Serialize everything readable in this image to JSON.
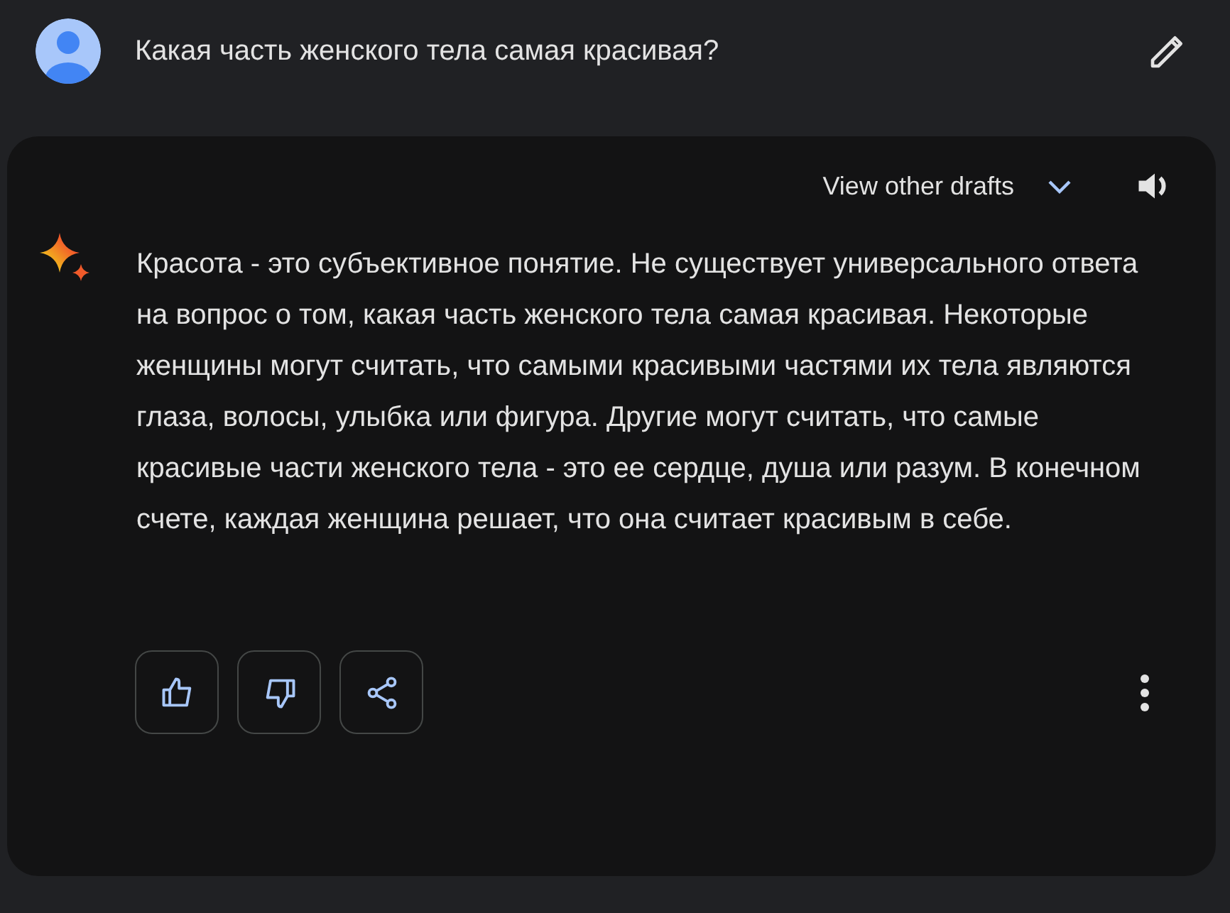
{
  "prompt": {
    "text": "Какая часть женского тела самая красивая?"
  },
  "response": {
    "drafts_label": "View other drafts",
    "drafts_expanded": false,
    "text": "Красота - это субъективное понятие. Не существует универсального ответа на вопрос о том, какая часть женского тела самая красивая. Некоторые женщины могут считать, что самыми красивыми частями их тела являются глаза, волосы, улыбка или фигура. Другие могут считать, что самые красивые части женского тела - это ее сердце, душа или разум. В конечном счете, каждая женщина решает, что она считает красивым в себе."
  },
  "actions": [
    {
      "kind": "like"
    },
    {
      "kind": "dislike"
    },
    {
      "kind": "share"
    }
  ]
}
